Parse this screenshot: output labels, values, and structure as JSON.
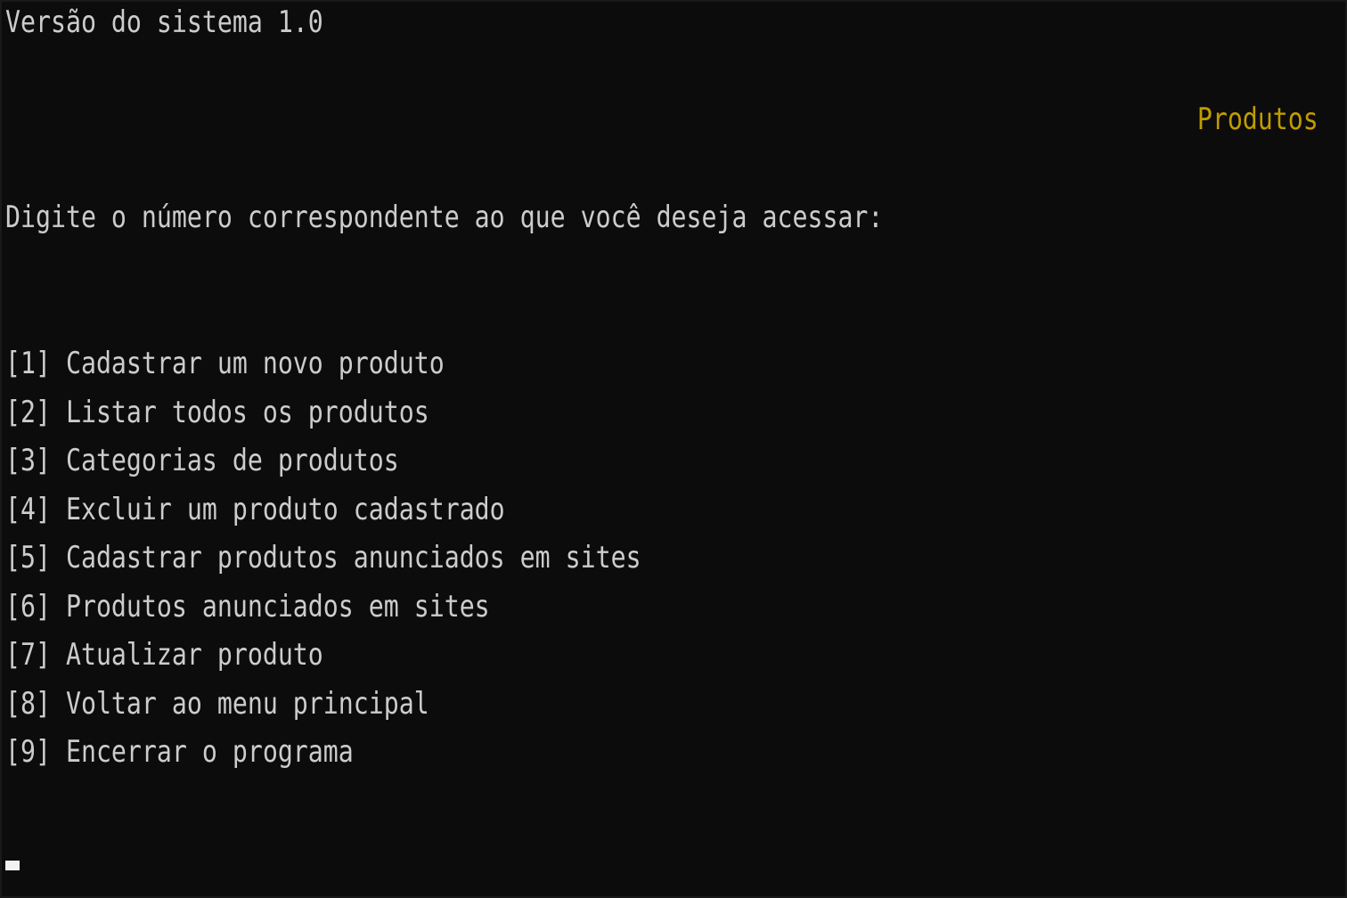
{
  "console": {
    "version_line": "Versão do sistema 1.0",
    "section_title": "Produtos",
    "prompt": "Digite o número correspondente ao que você deseja acessar:",
    "menu": [
      {
        "label": "[1] Cadastrar um novo produto"
      },
      {
        "label": "[2] Listar todos os produtos"
      },
      {
        "label": "[3] Categorias de produtos"
      },
      {
        "label": "[4] Excluir um produto cadastrado"
      },
      {
        "label": "[5] Cadastrar produtos anunciados em sites"
      },
      {
        "label": "[6] Produtos anunciados em sites"
      },
      {
        "label": "[7] Atualizar produto"
      },
      {
        "label": "[8] Voltar ao menu principal"
      },
      {
        "label": "[9] Encerrar o programa"
      }
    ],
    "colors": {
      "background": "#0c0c0c",
      "text": "#cccccc",
      "accent": "#c19c00",
      "cursor": "#f2f2f2"
    }
  }
}
